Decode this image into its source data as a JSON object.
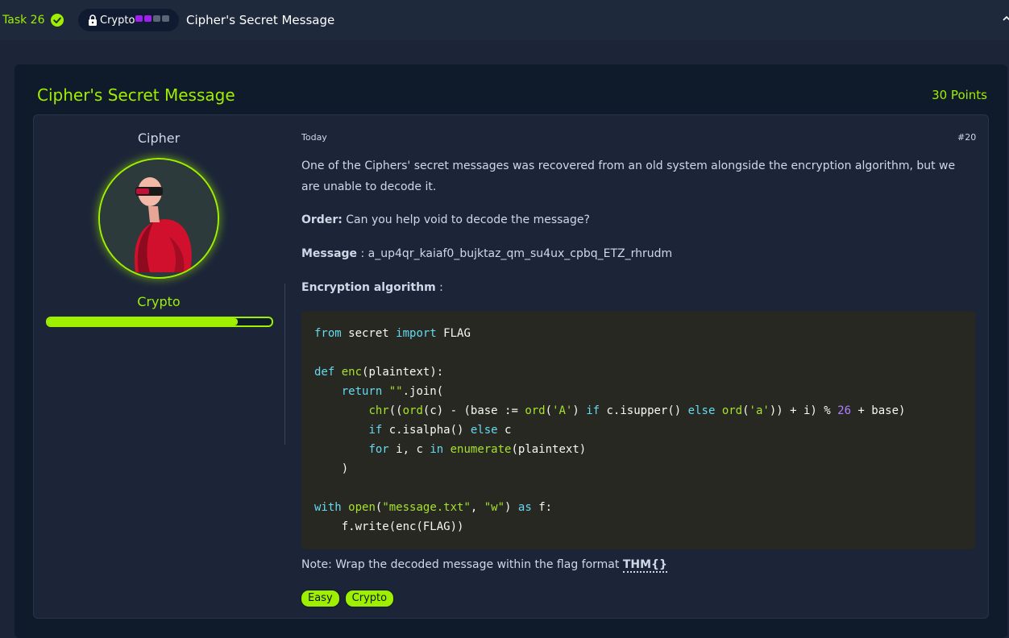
{
  "header": {
    "task_label": "Task 26",
    "room_tag": "Crypto",
    "title": "Cipher's Secret Message"
  },
  "card": {
    "title": "Cipher's Secret Message",
    "points": "30 Points"
  },
  "author": {
    "name": "Cipher",
    "role": "Crypto",
    "progress_fraction": 0.85
  },
  "post": {
    "date": "Today",
    "number": "#20",
    "intro": "One of the Ciphers' secret messages was recovered from an old system alongside the encryption algorithm, but we are unable to decode it.",
    "order_label": "Order:",
    "order_text": " Can you help void to decode the message?",
    "message_label": "Message",
    "message_text": " : a_up4qr_kaiaf0_bujktaz_qm_su4ux_cpbq_ETZ_rhrudm",
    "algo_label": "Encryption algorithm",
    "algo_suffix": " :",
    "note_text": "Note: Wrap the decoded message within the flag format ",
    "note_flag": "THM{}"
  },
  "tags": [
    "Easy",
    "Crypto"
  ],
  "colors": {
    "accent": "#9fef00",
    "background": "#1c2538",
    "card": "#0f1a2b",
    "code_bg": "#272822"
  },
  "icons": [
    "check-circle-icon",
    "lock-icon",
    "chevron-up-icon"
  ]
}
